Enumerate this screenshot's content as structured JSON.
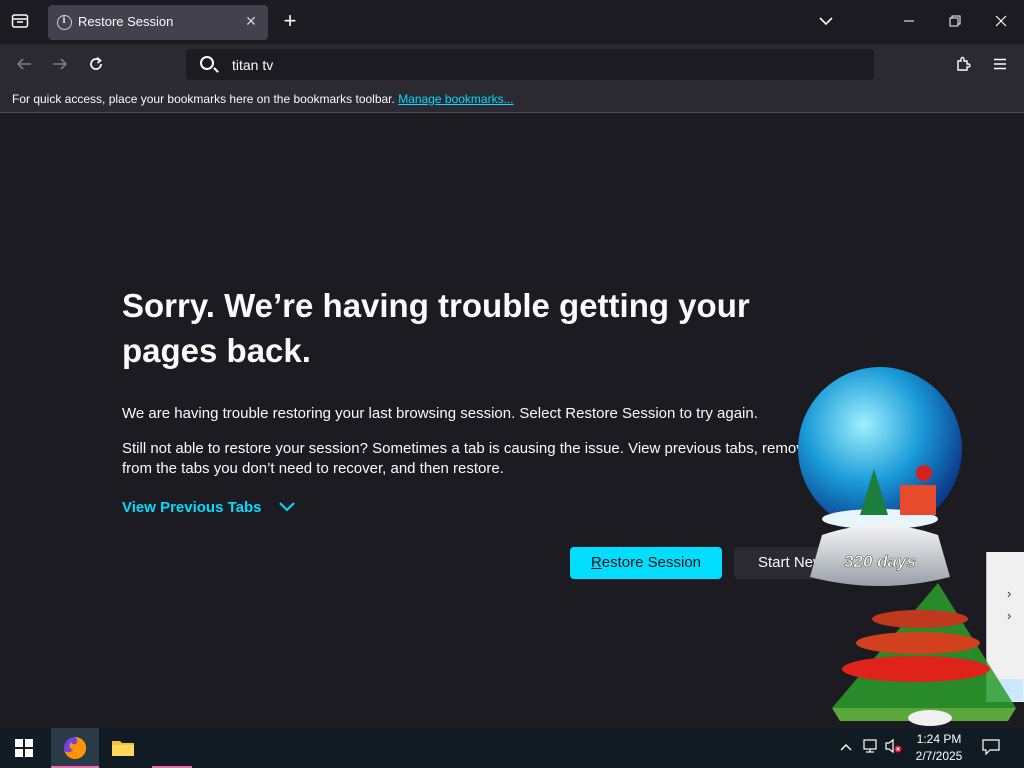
{
  "browser": {
    "tab_title": "Restore Session",
    "url_text": "titan tv",
    "bookmarks_message": "For quick access, place your bookmarks here on the bookmarks toolbar.",
    "bookmarks_link": "Manage bookmarks..."
  },
  "page": {
    "heading": "Sorry. We’re having trouble getting your pages back.",
    "para1": "We are having trouble restoring your last browsing session. Select Restore Session to try again.",
    "para2_line1": "Still not able to restore your session? Sometimes a tab is causing the issue. View previous tabs, remove",
    "para2_line2": "from the tabs you don’t need to recover, and then restore.",
    "view_previous_tabs": "View Previous Tabs",
    "restore_label_underlined": "R",
    "restore_label_rest": "estore Session",
    "new_session_label": "Start New Session"
  },
  "overlay": {
    "globe_label": "320 days"
  },
  "taskbar": {
    "time": "1:24 PM",
    "date": "2/7/2025"
  },
  "colors": {
    "accent": "#00ddff",
    "background": "#1c1b22",
    "toolbar": "#2b2a33"
  }
}
